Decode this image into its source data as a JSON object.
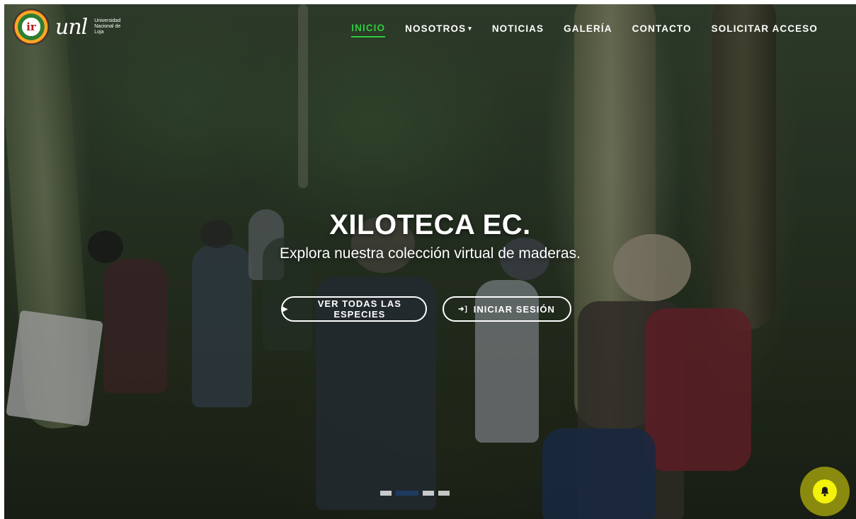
{
  "brand": {
    "seal_text": "ir",
    "unl_mark": "unl",
    "unl_subtitle": "Universidad Nacional de Loja"
  },
  "nav": {
    "items": [
      {
        "label": "Inicio",
        "active": true
      },
      {
        "label": "Nosotros",
        "has_dropdown": true
      },
      {
        "label": "Noticias"
      },
      {
        "label": "Galería"
      },
      {
        "label": "Contacto"
      },
      {
        "label": "Solicitar acceso"
      }
    ],
    "active_color": "#2ecc40"
  },
  "hero": {
    "title": "XILOTECA EC.",
    "subtitle": "Explora nuestra colección virtual de maderas.",
    "buttons": {
      "species_label": "VER TODAS LAS ESPECIES",
      "login_label": "INICIAR SESIÓN"
    }
  },
  "carousel": {
    "slide_count": 4,
    "active_index": 1
  },
  "notification": {
    "icon": "bell-icon",
    "color": "#f2f20a"
  }
}
